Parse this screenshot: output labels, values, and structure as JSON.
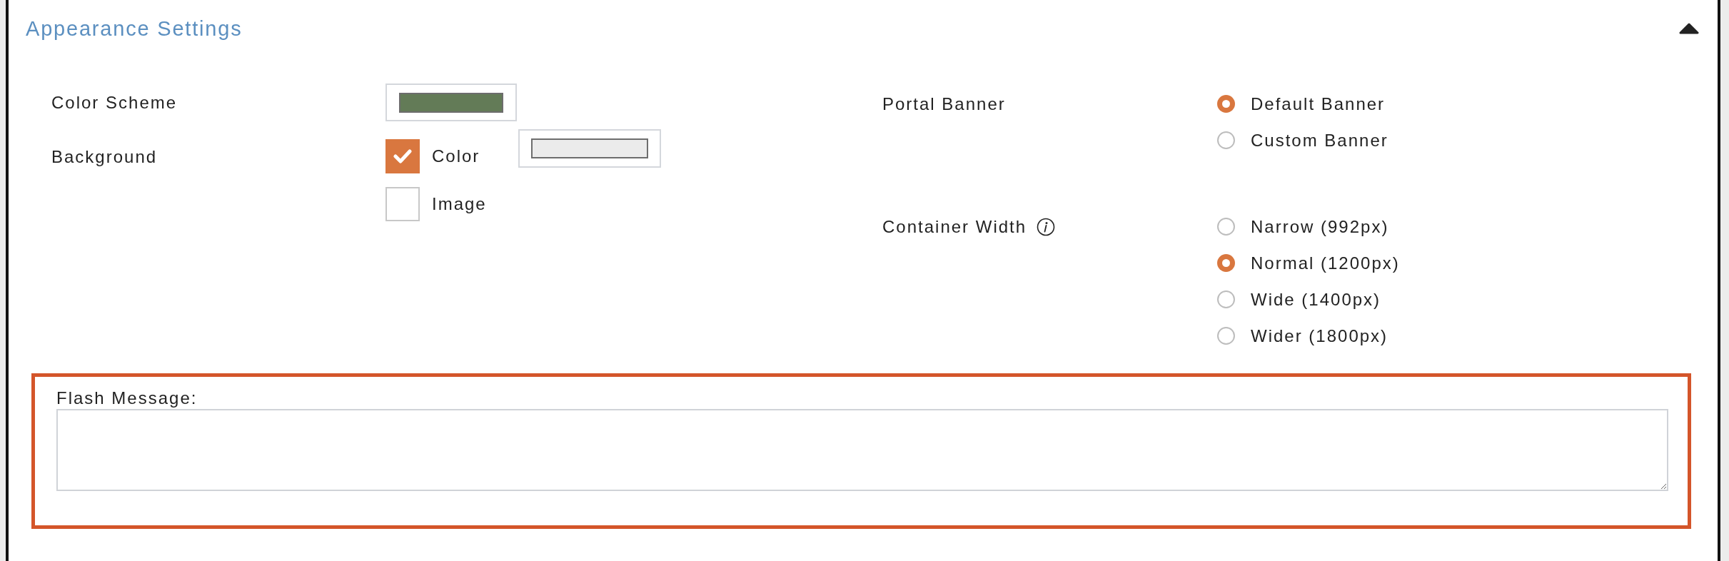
{
  "section": {
    "title": "Appearance Settings",
    "expanded": true
  },
  "color_scheme": {
    "label": "Color Scheme",
    "color": "#637b57"
  },
  "background": {
    "label": "Background",
    "options": [
      {
        "label": "Color",
        "checked": true,
        "color": "#ebebeb"
      },
      {
        "label": "Image",
        "checked": false
      }
    ]
  },
  "portal_banner": {
    "label": "Portal Banner",
    "options": [
      {
        "label": "Default Banner",
        "selected": true
      },
      {
        "label": "Custom Banner",
        "selected": false
      }
    ]
  },
  "container_width": {
    "label": "Container Width",
    "options": [
      {
        "label": "Narrow (992px)",
        "selected": false
      },
      {
        "label": "Normal (1200px)",
        "selected": true
      },
      {
        "label": "Wide (1400px)",
        "selected": false
      },
      {
        "label": "Wider (1800px)",
        "selected": false
      }
    ]
  },
  "flash_message": {
    "label": "Flash Message:",
    "highlighted": true
  }
}
